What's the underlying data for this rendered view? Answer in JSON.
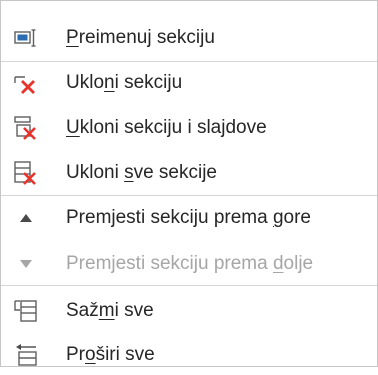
{
  "menu": {
    "items": [
      {
        "pre": "",
        "acc": "P",
        "post": "reimenuj sekciju",
        "icon": "rename-section-icon",
        "enabled": true
      },
      {
        "pre": "Uklo",
        "acc": "n",
        "post": "i sekciju",
        "icon": "remove-section-icon",
        "enabled": true
      },
      {
        "pre": "",
        "acc": "U",
        "post": "kloni sekciju i slajdove",
        "icon": "remove-section-and-slides-icon",
        "enabled": true
      },
      {
        "pre": "Ukloni ",
        "acc": "s",
        "post": "ve sekcije",
        "icon": "remove-all-sections-icon",
        "enabled": true
      },
      {
        "pre": "Premjesti sekciju prema ",
        "acc": "g",
        "post": "ore",
        "icon": "move-up-icon",
        "enabled": true
      },
      {
        "pre": "Premjesti sekciju prema ",
        "acc": "d",
        "post": "olje",
        "icon": "move-down-icon",
        "enabled": false
      },
      {
        "pre": "Saž",
        "acc": "m",
        "post": "i sve",
        "icon": "collapse-all-icon",
        "enabled": true
      },
      {
        "pre": "Pr",
        "acc": "o",
        "post": "širi sve",
        "icon": "expand-all-icon",
        "enabled": true
      }
    ]
  },
  "colors": {
    "accent_red": "#e8332a",
    "icon_gray": "#5f5f5f",
    "icon_blue": "#2b6cb0",
    "disabled_text": "#a6a6a6"
  }
}
